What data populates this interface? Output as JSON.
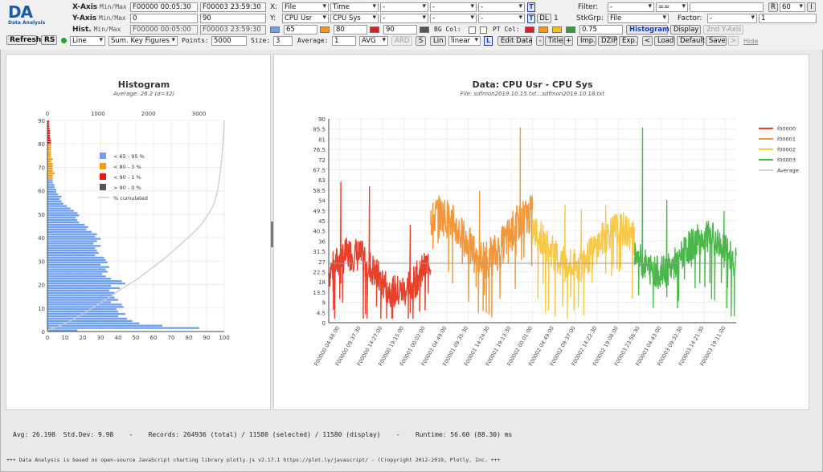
{
  "logo": {
    "text": "DA",
    "subtitle": "Data Analysis"
  },
  "toolbar": {
    "xaxis": {
      "label": "X-Axis",
      "minmax": "Min/Max",
      "min": "F00000 00:05:30",
      "max": "F00003 23:59:30"
    },
    "yaxis": {
      "label": "Y-Axis",
      "minmax": "Min/Max",
      "min": "0",
      "max": "90"
    },
    "hist": {
      "label": "Hist.",
      "minmax": "Min/Max",
      "min": "F00000 00:05:00",
      "max": "F00003 23:59:30"
    },
    "x_label": "X:",
    "x_selects": [
      "File",
      "Time",
      "-",
      "-",
      "-"
    ],
    "y_label": "Y:",
    "y_selects": [
      "CPU Usr",
      "CPU Sys",
      "-",
      "-",
      "-"
    ],
    "t_button": "T",
    "dl_button": "DL",
    "dl_value": "1",
    "thresholds": {
      "c1": "#6fa0ef",
      "v1": "65",
      "c2": "#f39c12",
      "v2": "80",
      "c3": "#e41a1c",
      "v3": "90",
      "c4": "#555555"
    },
    "bg_col_label": "BG Col:",
    "pt_col_label": "PT Col:",
    "pt_colors": [
      "#e41a1c",
      "#f39c12",
      "#f2c01d",
      "#2ca02c"
    ],
    "opacity": "0.75",
    "histogram_btn": "Histogram",
    "display_btn": "Display",
    "second_yaxis_btn": "2nd Y-Axis",
    "filter_label": "Filter:",
    "filter_field": "-",
    "filter_op": "==",
    "filter_value": "",
    "r_button": "R",
    "r_value": "60",
    "i_button": "I",
    "stkgrp_label": "StkGrp:",
    "stkgrp_value": "File",
    "factor_label": "Factor:",
    "factor_value": "-",
    "factor_input": "1",
    "refresh": "Refresh",
    "rs": "RS",
    "chart_type": "Line",
    "agg": "Sum. Key Figures",
    "points_label": "Points:",
    "points": "5000",
    "size_label": "Size:",
    "size": "3",
    "average_label": "Average:",
    "average": "1",
    "avg_func": "AVG",
    "ard": "ARD",
    "s": "S",
    "lin": "Lin",
    "scale": "linear",
    "l": "L",
    "edit_data": "Edit Data",
    "minus": "-",
    "title_btn": "Title",
    "plus": "+",
    "imp": "Imp.",
    "dzip": "DZIP",
    "exp": "Exp.",
    "lt": "<",
    "load": "Load",
    "default": "Default",
    "save": "Save",
    "gt": ">",
    "hide": "Hide"
  },
  "histogram": {
    "chart_data": {
      "type": "bar",
      "orientation": "horizontal",
      "title": "Histogram",
      "subtitle": "Average: 26.2 (σ=32)",
      "y_range": [
        0,
        90
      ],
      "y_ticks": [
        0,
        10,
        20,
        30,
        40,
        50,
        60,
        70,
        80,
        90
      ],
      "x_bottom_range": [
        0,
        100
      ],
      "x_bottom_ticks": [
        0,
        10,
        20,
        30,
        40,
        50,
        60,
        70,
        80,
        90,
        100
      ],
      "x_top_ticks": [
        0,
        1000,
        2000,
        3000
      ],
      "bins": [
        [
          0,
          17,
          "blue"
        ],
        [
          1,
          86,
          "blue"
        ],
        [
          2,
          65,
          "blue"
        ],
        [
          3,
          52,
          "blue"
        ],
        [
          4,
          48,
          "blue"
        ],
        [
          5,
          45,
          "blue"
        ],
        [
          6,
          40,
          "blue"
        ],
        [
          7,
          44,
          "blue"
        ],
        [
          8,
          40,
          "blue"
        ],
        [
          9,
          39,
          "blue"
        ],
        [
          10,
          43,
          "blue"
        ],
        [
          11,
          42,
          "blue"
        ],
        [
          12,
          36,
          "blue"
        ],
        [
          13,
          40,
          "blue"
        ],
        [
          14,
          38,
          "blue"
        ],
        [
          15,
          37,
          "blue"
        ],
        [
          16,
          38,
          "blue"
        ],
        [
          17,
          35,
          "blue"
        ],
        [
          18,
          41,
          "blue"
        ],
        [
          19,
          36,
          "blue"
        ],
        [
          20,
          44,
          "blue"
        ],
        [
          21,
          42,
          "blue"
        ],
        [
          22,
          36,
          "blue"
        ],
        [
          23,
          33,
          "blue"
        ],
        [
          24,
          31,
          "blue"
        ],
        [
          25,
          34,
          "blue"
        ],
        [
          26,
          33,
          "blue"
        ],
        [
          27,
          35,
          "blue"
        ],
        [
          28,
          30,
          "blue"
        ],
        [
          29,
          34,
          "blue"
        ],
        [
          30,
          33,
          "blue"
        ],
        [
          31,
          32,
          "blue"
        ],
        [
          32,
          27,
          "blue"
        ],
        [
          33,
          29,
          "blue"
        ],
        [
          34,
          28,
          "blue"
        ],
        [
          35,
          27,
          "blue"
        ],
        [
          36,
          30,
          "blue"
        ],
        [
          37,
          26,
          "blue"
        ],
        [
          38,
          28,
          "blue"
        ],
        [
          39,
          30,
          "blue"
        ],
        [
          40,
          27,
          "blue"
        ],
        [
          41,
          28,
          "blue"
        ],
        [
          42,
          25,
          "blue"
        ],
        [
          43,
          22,
          "blue"
        ],
        [
          44,
          23,
          "blue"
        ],
        [
          45,
          21,
          "blue"
        ],
        [
          46,
          18,
          "blue"
        ],
        [
          47,
          17,
          "blue"
        ],
        [
          48,
          16,
          "blue"
        ],
        [
          49,
          18,
          "blue"
        ],
        [
          50,
          17,
          "blue"
        ],
        [
          51,
          15,
          "blue"
        ],
        [
          52,
          13,
          "blue"
        ],
        [
          53,
          11,
          "blue"
        ],
        [
          54,
          9,
          "blue"
        ],
        [
          55,
          8,
          "blue"
        ],
        [
          56,
          7,
          "blue"
        ],
        [
          57,
          8,
          "blue"
        ],
        [
          58,
          6,
          "blue"
        ],
        [
          59,
          5,
          "blue"
        ],
        [
          60,
          5,
          "blue"
        ],
        [
          61,
          4,
          "blue"
        ],
        [
          62,
          4,
          "blue"
        ],
        [
          63,
          3,
          "blue"
        ],
        [
          64,
          3,
          "blue"
        ],
        [
          65,
          3,
          "orange"
        ],
        [
          66,
          3,
          "orange"
        ],
        [
          67,
          4,
          "orange"
        ],
        [
          68,
          3,
          "orange"
        ],
        [
          69,
          3,
          "orange"
        ],
        [
          70,
          3,
          "orange"
        ],
        [
          71,
          3,
          "orange"
        ],
        [
          72,
          2,
          "orange"
        ],
        [
          73,
          3,
          "orange"
        ],
        [
          74,
          2,
          "orange"
        ],
        [
          75,
          2,
          "orange"
        ],
        [
          76,
          2,
          "orange"
        ],
        [
          77,
          2,
          "orange"
        ],
        [
          78,
          2,
          "orange"
        ],
        [
          79,
          2,
          "orange"
        ],
        [
          80,
          2,
          "red"
        ],
        [
          81,
          2,
          "red"
        ],
        [
          82,
          1.5,
          "red"
        ],
        [
          83,
          1.5,
          "red"
        ],
        [
          84,
          1.5,
          "red"
        ],
        [
          85,
          1.5,
          "red"
        ],
        [
          86,
          1.2,
          "red"
        ],
        [
          87,
          1,
          "red"
        ],
        [
          88,
          1,
          "red"
        ],
        [
          89,
          1,
          "red"
        ]
      ],
      "legend": [
        {
          "label": "< 65 - 95 %",
          "color": "#6fa0ef"
        },
        {
          "label": "< 80 - 3 %",
          "color": "#f39c12"
        },
        {
          "label": "< 90 - 1 %",
          "color": "#e41a1c"
        },
        {
          "label": "> 90 - 0 %",
          "color": "#555555"
        },
        {
          "label": "% cumulated",
          "color": "#cccccc"
        }
      ]
    }
  },
  "main_chart": {
    "chart_data": {
      "type": "line",
      "title": "Data: CPU Usr - CPU Sys",
      "subtitle": "File: sdfmon2019.10.15.txt...sdfmon2019.10.18.txt",
      "y_range": [
        0,
        90
      ],
      "y_ticks": [
        0,
        4.5,
        9,
        13.5,
        18,
        22.5,
        27,
        31.5,
        36,
        40.5,
        45,
        49.5,
        54,
        58.5,
        63,
        67.5,
        72,
        76.5,
        81,
        85.5,
        90
      ],
      "average": 26.2,
      "x_tick_labels": [
        "F00000 04:48:00",
        "F00000 09:37:30",
        "F00000 14:27:00",
        "F00000 19:15:00",
        "F00001 00:02:00",
        "F00001 04:49:00",
        "F00001 09:35:30",
        "F00001 14:24:30",
        "F00001 19:13:30",
        "F00002 00:01:00",
        "F00002 04:49:00",
        "F00002 09:37:00",
        "F00002 14:22:30",
        "F00002 19:08:00",
        "F00003 23:56:30",
        "F00003 04:43:00",
        "F00003 09:32:30",
        "F00003 14:21:30",
        "F00003 19:11:00"
      ],
      "series": [
        {
          "name": "f00000",
          "color": "#e8412b",
          "x_from": 0,
          "x_to": 0.25,
          "base": 22,
          "amp": 14,
          "spikes": [
            [
              0.03,
              62
            ],
            [
              0.1,
              60
            ],
            [
              0.2,
              43
            ]
          ]
        },
        {
          "name": "f00001",
          "color": "#f0983b",
          "x_from": 0.25,
          "x_to": 0.5,
          "base": 38,
          "amp": 16,
          "spikes": [
            [
              0.37,
              58
            ],
            [
              0.44,
              37
            ],
            [
              0.47,
              86
            ]
          ]
        },
        {
          "name": "f00002",
          "color": "#f7c946",
          "x_from": 0.5,
          "x_to": 0.75,
          "base": 33,
          "amp": 14,
          "spikes": [
            [
              0.58,
              52
            ],
            [
              0.62,
              50
            ],
            [
              0.68,
              52
            ]
          ]
        },
        {
          "name": "f00003",
          "color": "#4cb84c",
          "x_from": 0.75,
          "x_to": 1,
          "base": 30,
          "amp": 13,
          "spikes": [
            [
              0.77,
              86
            ],
            [
              0.83,
              54
            ],
            [
              0.97,
              49
            ]
          ]
        },
        {
          "name": "Average",
          "color": "#aaaaaa"
        }
      ]
    }
  },
  "status": {
    "avg": "Avg: 26.198",
    "stddev": "Std.Dev: 9.98",
    "records": "Records: 264936 (total) / 11580 (selected) / 11580 (display)",
    "runtime": "Runtime: 56.60 (88.30) ms"
  },
  "footer": "+++ Data Analysis is based on open-source JavaScript charting library plotly.js v2.17.1 https://plot.ly/javascript/ - (C)opyright 2012-2019, Plotly, Inc. +++"
}
